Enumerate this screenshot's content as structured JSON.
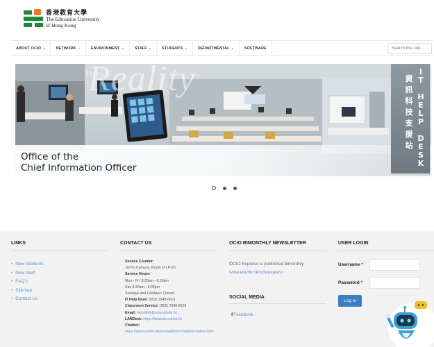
{
  "header": {
    "logo_cn": "香港教育大學",
    "logo_en_1": "The Education University",
    "logo_en_2": "of Hong Kong"
  },
  "nav": {
    "items": [
      {
        "label": "ABOUT OCIO",
        "has_dropdown": true
      },
      {
        "label": "NETWORK",
        "has_dropdown": true
      },
      {
        "label": "ENVIRONMENT",
        "has_dropdown": true
      },
      {
        "label": "STAFF",
        "has_dropdown": true
      },
      {
        "label": "STUDENTS",
        "has_dropdown": true
      },
      {
        "label": "DEPARTMENTAL",
        "has_dropdown": true
      },
      {
        "label": "SOFTWARE",
        "has_dropdown": false
      }
    ],
    "search_placeholder": "Search this site..."
  },
  "banner": {
    "watermark": "Reality",
    "watermark_small": "Virtual",
    "caption_line1": "Office of the",
    "caption_line2": "Chief Information Officer",
    "sign_en": "IT HELP DESK",
    "sign_cn": "資訊科技支援站"
  },
  "carousel": {
    "slides": 3,
    "active": 0
  },
  "footer": {
    "links": {
      "title": "LINKS",
      "items": [
        "New Students",
        "New Staff",
        "FAQ's",
        "Sitemap",
        "Contact Us"
      ]
    },
    "contact": {
      "title": "CONTACT US",
      "service_counter_label": "Service Counter:",
      "service_counter": "Tai Po Campus, Room D-LP-20",
      "service_hours_label": "Service Hours:",
      "hours_weekday": "Mon - Fri: 8:30am - 6:30pm",
      "hours_sat": "Sat: 8:30am - 5:00pm",
      "hours_closed": "Sundays and Holidays: Closed",
      "helpdesk_label": "IT Help Desk:",
      "helpdesk": "(852) 2948-6601",
      "classroom_label": "Classroom Service:",
      "classroom": "(852) 2948-6529",
      "email_label": "Email:",
      "email": "helpdesk@ocio.eduhk.hk",
      "landesk_label": "LANDesk:",
      "landesk": "https://landesk.eduhk.hk",
      "chatbot_label": "Chatbot:",
      "chatbot": "https://www.eduhk.hk/ocio/webdoc/chatbot/chatbot.html"
    },
    "newsletter": {
      "title": "OCIO BIMONTHLY NEWSLETTER",
      "text": "OCIO Express is published bimonthly -",
      "link": "www.eduhk.hk/ocioexpress"
    },
    "social": {
      "title": "SOCIAL MEDIA",
      "facebook_glyph": "f",
      "facebook": "Facebook"
    },
    "login": {
      "title": "USER LOGIN",
      "username_label": "Username",
      "password_label": "Password",
      "required_mark": "*",
      "button": "Log in"
    }
  }
}
